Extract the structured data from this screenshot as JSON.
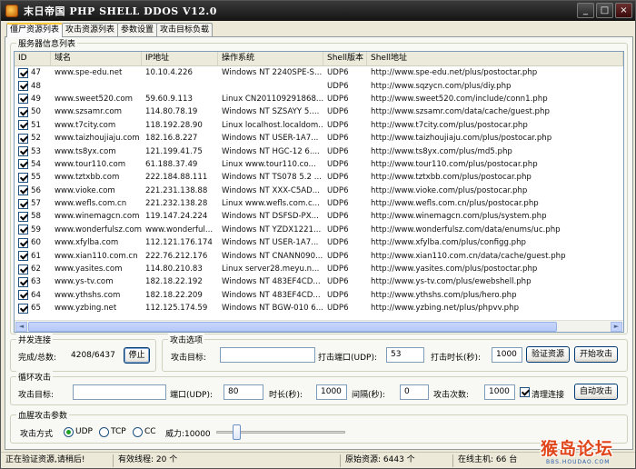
{
  "window": {
    "title": "末日帝国 PHP SHELL DDOS V12.0",
    "minimize": "_",
    "maximize": "□",
    "close": "×"
  },
  "tabs": [
    {
      "label": "僵尸资源列表",
      "active": true
    },
    {
      "label": "攻击资源列表",
      "active": false
    },
    {
      "label": "参数设置",
      "active": false
    },
    {
      "label": "攻击目标负载",
      "active": false
    }
  ],
  "server_list": {
    "group_title": "服务器信息列表",
    "columns": [
      "ID",
      "域名",
      "IP地址",
      "操作系统",
      "Shell版本",
      "Shell地址"
    ],
    "rows": [
      [
        "47",
        "www.spe-edu.net",
        "10.10.4.226",
        "Windows NT 2240SPE-S...",
        "UDP6",
        "http://www.spe-edu.net/plus/postoctar.php"
      ],
      [
        "48",
        "",
        "",
        "",
        "UDP6",
        "http://www.sqzycn.com/plus/diy.php"
      ],
      [
        "49",
        "www.sweet520.com",
        "59.60.9.113",
        "Linux CN201109291868...",
        "UDP6",
        "http://www.sweet520.com/include/conn1.php"
      ],
      [
        "50",
        "www.szsamr.com",
        "114.80.78.19",
        "Windows NT SZSAYY 5....",
        "UDP6",
        "http://www.szsamr.com/data/cache/guest.php"
      ],
      [
        "51",
        "www.t7city.com",
        "118.192.28.90",
        "Linux localhost.localdom...",
        "UDP6",
        "http://www.t7city.com/plus/postocar.php"
      ],
      [
        "52",
        "www.taizhoujiaju.com",
        "182.16.8.227",
        "Windows NT USER-1A7...",
        "UDP6",
        "http://www.taizhoujiaju.com/plus/postocar.php"
      ],
      [
        "53",
        "www.ts8yx.com",
        "121.199.41.75",
        "Windows NT HGC-12 6....",
        "UDP6",
        "http://www.ts8yx.com/plus/md5.php"
      ],
      [
        "54",
        "www.tour110.com",
        "61.188.37.49",
        "Linux www.tour110.co...",
        "UDP6",
        "http://www.tour110.com/plus/postocar.php"
      ],
      [
        "55",
        "www.tztxbb.com",
        "222.184.88.111",
        "Windows NT TS078 5.2 ...",
        "UDP6",
        "http://www.tztxbb.com/plus/postocar.php"
      ],
      [
        "56",
        "www.vioke.com",
        "221.231.138.88",
        "Windows NT XXX-C5AD...",
        "UDP6",
        "http://www.vioke.com/plus/postocar.php"
      ],
      [
        "57",
        "www.wefls.com.cn",
        "221.232.138.28",
        "Linux www.wefls.com.c...",
        "UDP6",
        "http://www.wefls.com.cn/plus/postocar.php"
      ],
      [
        "58",
        "www.winemagcn.com",
        "119.147.24.224",
        "Windows NT DSFSD-PX...",
        "UDP6",
        "http://www.winemagcn.com/plus/system.php"
      ],
      [
        "59",
        "www.wonderfulsz.com",
        "www.wonderful...",
        "Windows NT YZDX1221...",
        "UDP6",
        "http://www.wonderfulsz.com/data/enums/uc.php"
      ],
      [
        "60",
        "www.xfylba.com",
        "112.121.176.174",
        "Windows NT USER-1A7...",
        "UDP6",
        "http://www.xfylba.com/plus/configg.php"
      ],
      [
        "61",
        "www.xian110.com.cn",
        "222.76.212.176",
        "Windows NT CNANN090...",
        "UDP6",
        "http://www.xian110.com.cn/data/cache/guest.php"
      ],
      [
        "62",
        "www.yasites.com",
        "114.80.210.83",
        "Linux server28.meyu.n...",
        "UDP6",
        "http://www.yasites.com/plus/postoctar.php"
      ],
      [
        "63",
        "www.ys-tv.com",
        "182.18.22.192",
        "Windows NT 483EF4CD...",
        "UDP6",
        "http://www.ys-tv.com/plus/ewebshell.php"
      ],
      [
        "64",
        "www.ythshs.com",
        "182.18.22.209",
        "Windows NT 483EF4CD...",
        "UDP6",
        "http://www.ythshs.com/plus/hero.php"
      ],
      [
        "65",
        "www.yzbing.net",
        "112.125.174.59",
        "Windows NT BGW-010 6...",
        "UDP6",
        "http://www.yzbing.net/plus/phpvv.php"
      ]
    ],
    "scroll_left": "◄",
    "scroll_right": "►"
  },
  "concurrent": {
    "group_title": "并发连接",
    "progress_label": "完成/总数:",
    "progress_value": "4208/6437",
    "stop_button": "停止"
  },
  "attack_options": {
    "group_title": "攻击选项",
    "target_label": "攻击目标:",
    "target_value": "",
    "port_label": "打击端口(UDP):",
    "port_value": "53",
    "duration_label": "打击时长(秒):",
    "duration_value": "1000",
    "verify_button": "验证资源",
    "start_button": "开始攻击"
  },
  "loop_attack": {
    "group_title": "循环攻击",
    "target_label": "攻击目标:",
    "target_value": "",
    "port_label": "端口(UDP):",
    "port_value": "80",
    "duration_label": "时长(秒):",
    "duration_value": "1000",
    "interval_label": "间隔(秒):",
    "interval_value": "0",
    "count_label": "攻击次数:",
    "count_value": "1000",
    "clean_label": "清理连接",
    "clean_checked": true,
    "auto_button": "自动攻击"
  },
  "bloody_params": {
    "group_title": "血腥攻击参数",
    "mode_label": "攻击方式",
    "modes": [
      {
        "label": "UDP",
        "selected": true
      },
      {
        "label": "TCP",
        "selected": false
      },
      {
        "label": "CC",
        "selected": false
      }
    ],
    "power_label": "威力:10000",
    "power_level": 0.13
  },
  "status": {
    "message": "正在验证资源,请稍后!",
    "threads_label": "有效线程:",
    "threads_value": "20 个",
    "resources_label": "原始资源:",
    "resources_value": "6443 个",
    "online_label": "在线主机:",
    "online_value": "66 台"
  },
  "watermark": {
    "main": "猴岛论坛",
    "sub": "BBS.HOUDAO.COM"
  }
}
